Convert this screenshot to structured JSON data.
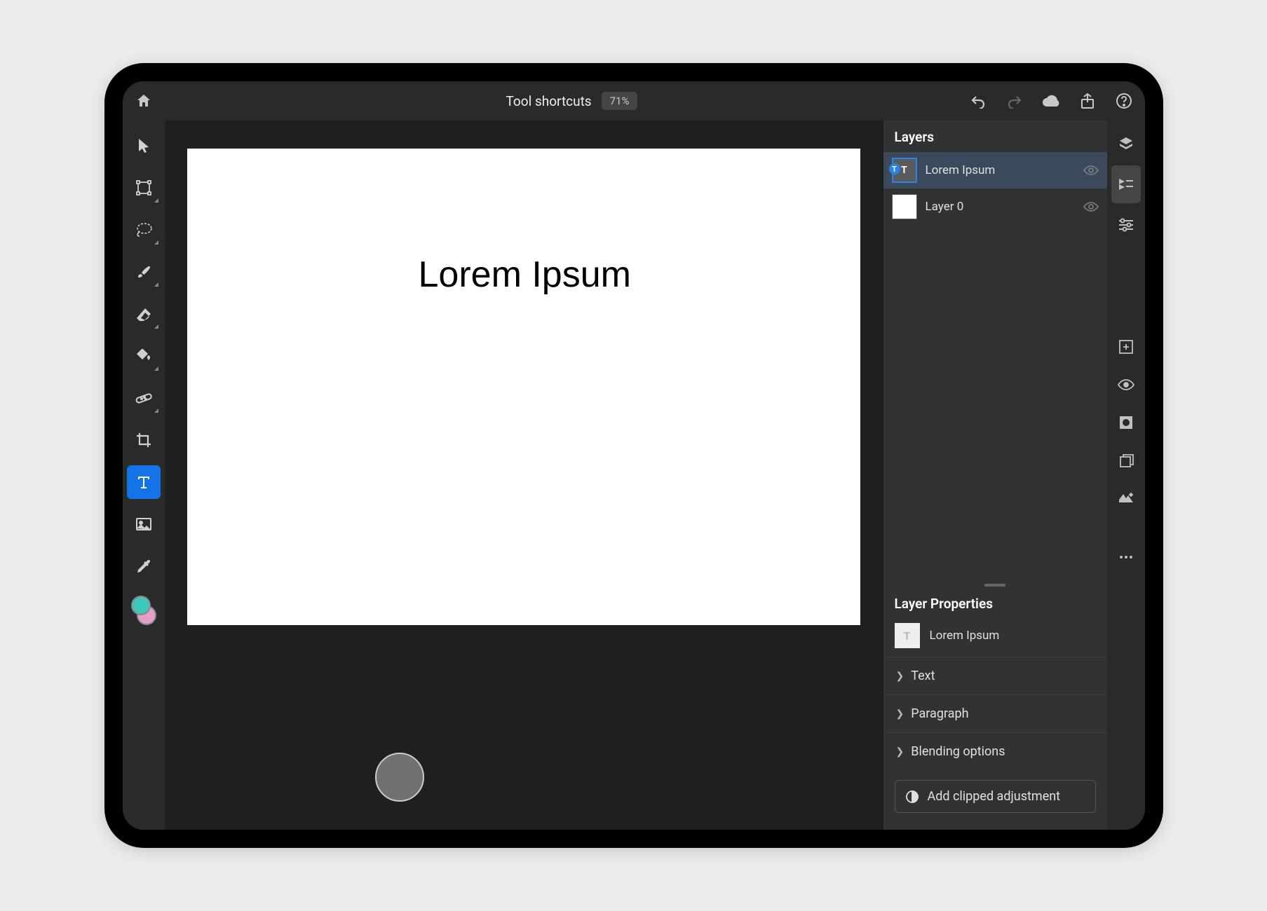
{
  "header": {
    "document_title": "Tool shortcuts",
    "zoom_label": "71%"
  },
  "canvas": {
    "text_content": "Lorem Ipsum"
  },
  "colors": {
    "foreground": "#3fc7bb",
    "background": "#e79ecb",
    "accent": "#1473e6"
  },
  "layers_panel": {
    "title": "Layers",
    "items": [
      {
        "name": "Lorem Ipsum",
        "type": "text",
        "selected": true
      },
      {
        "name": "Layer 0",
        "type": "pixel",
        "selected": false
      }
    ]
  },
  "properties_panel": {
    "title": "Layer Properties",
    "layer_name": "Lorem Ipsum",
    "sections": {
      "text": "Text",
      "paragraph": "Paragraph",
      "blending": "Blending options"
    },
    "clipped_button": "Add clipped adjustment"
  }
}
